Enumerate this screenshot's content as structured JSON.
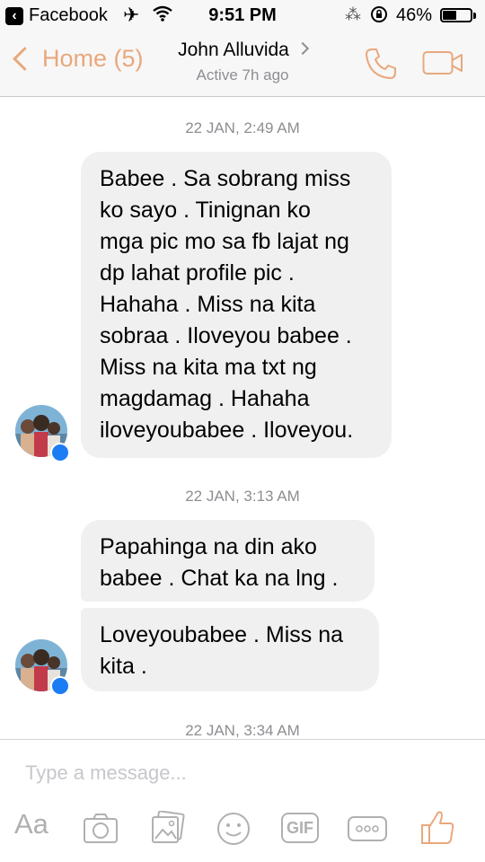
{
  "status_bar": {
    "back_app": "Facebook",
    "time": "9:51 PM",
    "battery": "46%",
    "battery_level": 0.46
  },
  "nav": {
    "back_label": "Home (5)",
    "contact_name": "John Alluvida",
    "active_status": "Active 7h ago"
  },
  "thread": [
    {
      "timestamp": "22 JAN, 2:49 AM"
    },
    {
      "text": "Babee . Sa sobrang miss\nko sayo . Tinignan ko\nmga pic mo sa fb lajat ng\ndp lahat profile pic .\nHahaha . Miss na kita\nsobraa . Iloveyou babee .\nMiss na kita ma txt ng\nmagdamag . Hahaha\niloveyoubabee . Iloveyou."
    },
    {
      "timestamp": "22 JAN, 3:13 AM"
    },
    {
      "text": "Papahinga na din ako\nbabee . Chat ka na lng ."
    },
    {
      "text": "Loveyoubabee . Miss na\nkita ."
    },
    {
      "timestamp": "22 JAN, 3:34 AM"
    }
  ],
  "composer": {
    "placeholder": "Type a message...",
    "aa_label": "Aa",
    "gif_label": "GIF"
  },
  "colors": {
    "accent": "#e8a87c",
    "bubble": "#f1f0f0",
    "timestamp": "#8e8e93",
    "messenger_badge": "#1c7cf4"
  },
  "icons": [
    "airplane-icon",
    "wifi-icon",
    "lock-rotation-icon",
    "battery-icon",
    "phone-icon",
    "video-icon",
    "camera-icon",
    "photo-icon",
    "smiley-icon",
    "gif-icon",
    "more-icon",
    "thumbs-up-icon"
  ]
}
